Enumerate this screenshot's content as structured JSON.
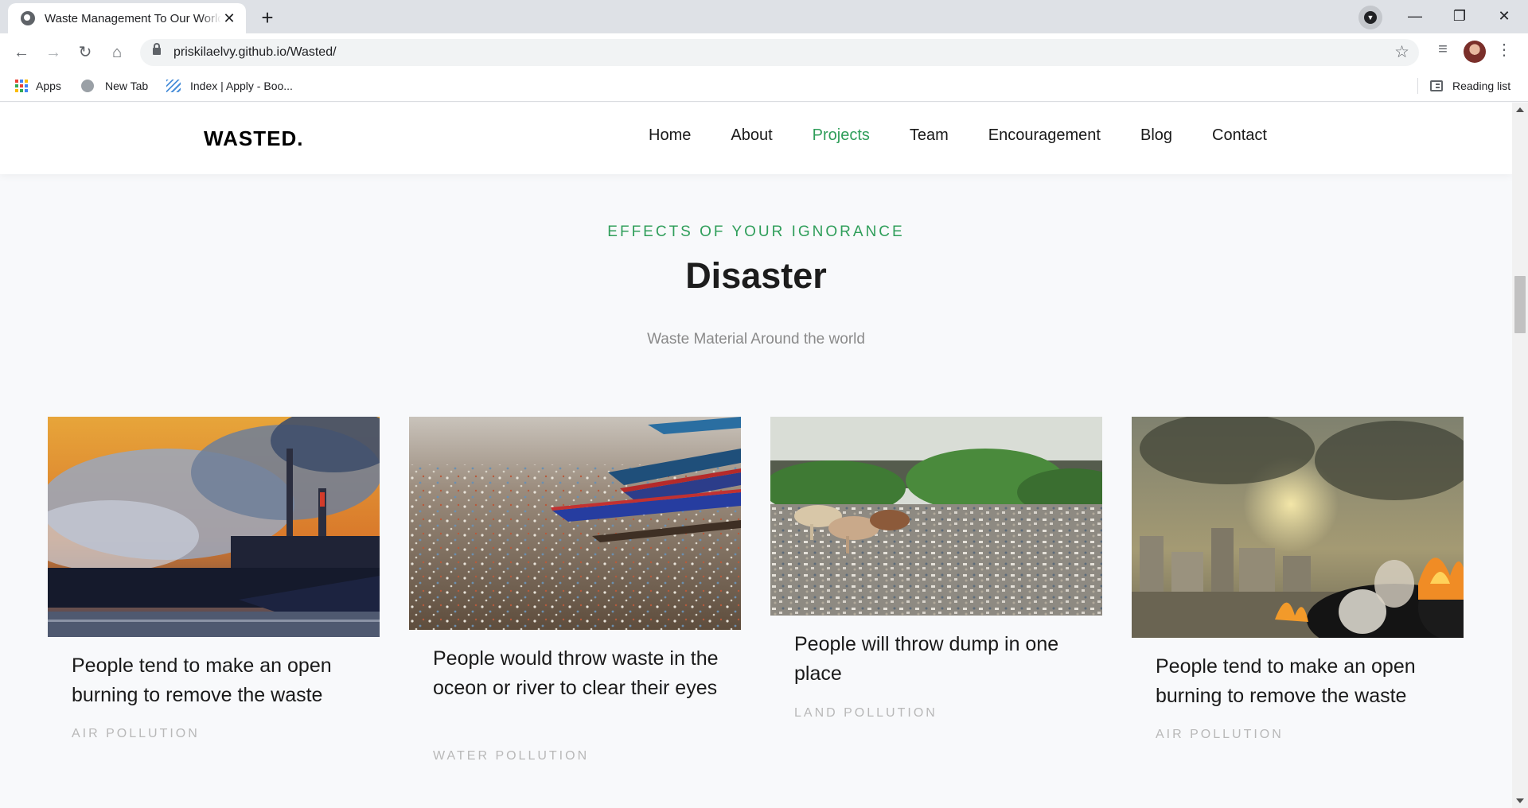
{
  "browser": {
    "tab_title": "Waste Management To Our World",
    "tab_close": "✕",
    "new_tab": "+",
    "url": "priskilaelvy.github.io/Wasted/",
    "window_controls": {
      "minimize": "—",
      "restore": "❐",
      "close": "✕"
    },
    "bookmarks": [
      {
        "label": "Apps",
        "icon": "apps-grid-icon"
      },
      {
        "label": "New Tab",
        "icon": "globe-icon"
      },
      {
        "label": "Index | Apply - Boo...",
        "icon": "stripe-icon"
      }
    ],
    "reading_list": "Reading list"
  },
  "site": {
    "logo": "WASTED.",
    "nav": [
      {
        "label": "Home",
        "active": false
      },
      {
        "label": "About",
        "active": false
      },
      {
        "label": "Projects",
        "active": true
      },
      {
        "label": "Team",
        "active": false
      },
      {
        "label": "Encouragement",
        "active": false
      },
      {
        "label": "Blog",
        "active": false
      },
      {
        "label": "Contact",
        "active": false
      }
    ],
    "accent_color": "#2f9e5a"
  },
  "section": {
    "kicker": "EFFECTS OF YOUR IGNORANCE",
    "title": "Disaster",
    "subtitle": "Waste Material Around the world"
  },
  "cards": [
    {
      "title": "People tend to make an open burning to remove the waste",
      "category": "AIR POLLUTION",
      "image": "factory-smoke-photo"
    },
    {
      "title": "People would throw waste in the oceon or river to clear their eyes",
      "category": "WATER POLLUTION",
      "image": "polluted-shore-boats-photo"
    },
    {
      "title": "People will throw dump in one place",
      "category": "LAND POLLUTION",
      "image": "landfill-cows-photo"
    },
    {
      "title": "People tend to make an open burning to remove the waste",
      "category": "AIR POLLUTION",
      "image": "burning-garbage-city-photo"
    }
  ]
}
